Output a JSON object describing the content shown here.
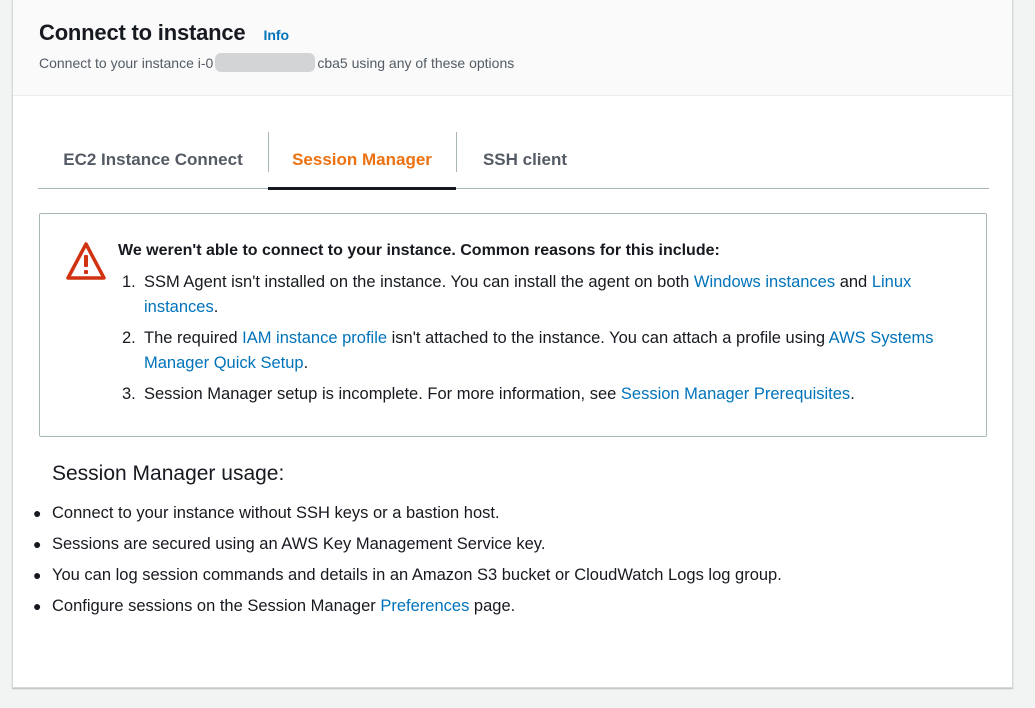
{
  "header": {
    "title": "Connect to instance",
    "info_link": "Info",
    "subtitle_prefix": "Connect to your instance i-0",
    "subtitle_suffix": "cba5 using any of these options"
  },
  "tabs": [
    {
      "label": "EC2 Instance Connect",
      "active": false
    },
    {
      "label": "Session Manager",
      "active": true
    },
    {
      "label": "SSH client",
      "active": false
    }
  ],
  "alert": {
    "title": "We weren't able to connect to your instance. Common reasons for this include:",
    "items": [
      {
        "num": "1.",
        "text_a": "SSM Agent isn't installed on the instance. You can install the agent on both ",
        "link_a": "Windows instances",
        "text_b": " and ",
        "link_b": "Linux instances",
        "text_c": "."
      },
      {
        "num": "2.",
        "text_a": "The required ",
        "link_a": "IAM instance profile",
        "text_b": " isn't attached to the instance. You can attach a profile using ",
        "link_b": "AWS Systems Manager Quick Setup",
        "text_c": "."
      },
      {
        "num": "3.",
        "text_a": "Session Manager setup is incomplete. For more information, see ",
        "link_a": "Session Manager Prerequisites",
        "text_b": "."
      }
    ]
  },
  "usage": {
    "title": "Session Manager usage:",
    "items": [
      {
        "text": "Connect to your instance without SSH keys or a bastion host."
      },
      {
        "text": "Sessions are secured using an AWS Key Management Service key."
      },
      {
        "text": "You can log session commands and details in an Amazon S3 bucket or CloudWatch Logs log group."
      },
      {
        "text_a": "Configure sessions on the Session Manager ",
        "link": "Preferences",
        "text_b": " page."
      }
    ]
  },
  "colors": {
    "active_tab": "#ec7211",
    "link": "#0073bb",
    "warning": "#d13212"
  },
  "icons": {
    "alert": "warning-triangle-icon",
    "bullet": "bullet-dot"
  }
}
